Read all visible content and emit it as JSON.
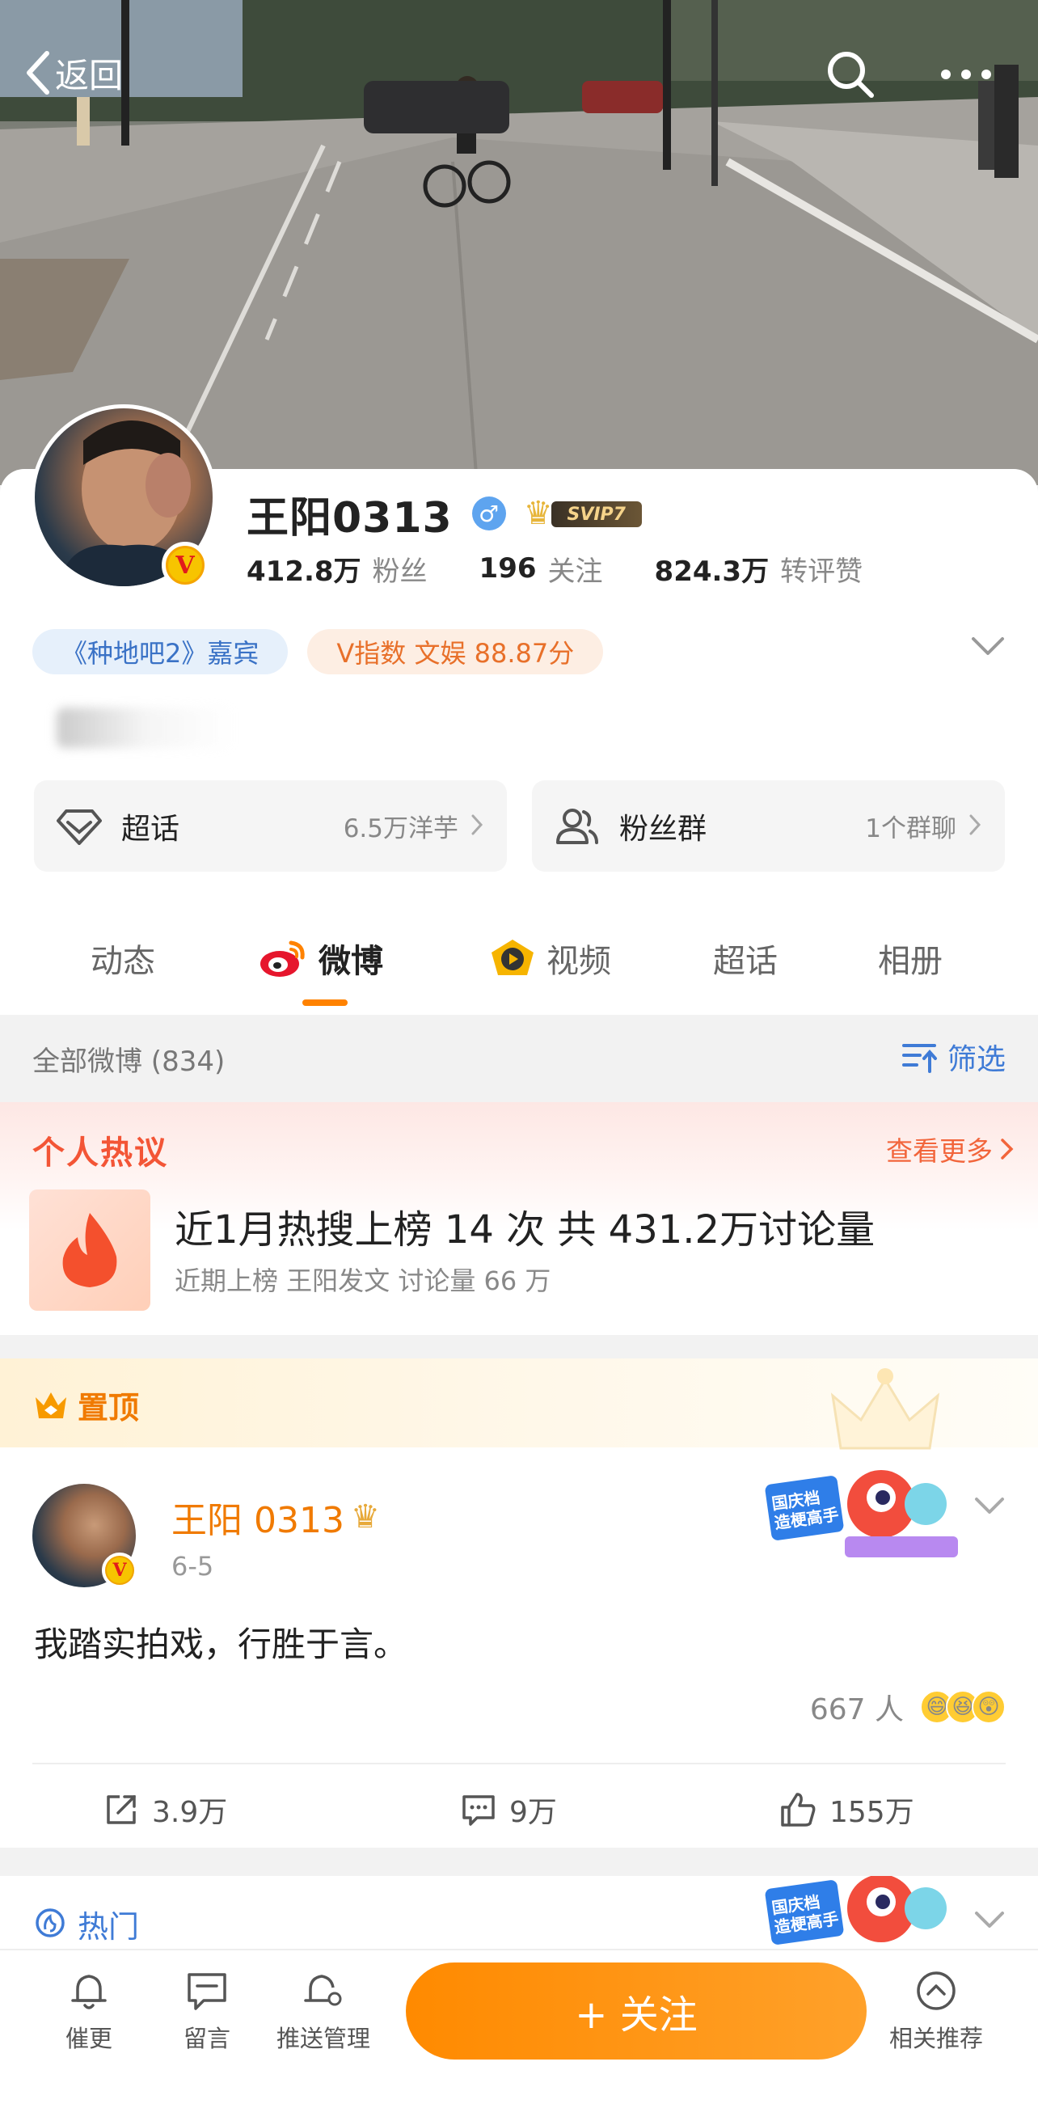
{
  "topbar": {
    "back_label": "返回"
  },
  "profile": {
    "name": "王阳0313",
    "gender_symbol": "♂",
    "svip_label": "SVIP7",
    "verified_mark": "V",
    "stats": [
      {
        "value": "412.8万",
        "label": "粉丝"
      },
      {
        "value": "196",
        "label": "关注"
      },
      {
        "value": "824.3万",
        "label": "转评赞"
      }
    ],
    "tags": [
      "《种地吧2》嘉宾",
      "V指数 文娱 88.87分"
    ],
    "entries": [
      {
        "label": "超话",
        "value": "6.5万洋芋"
      },
      {
        "label": "粉丝群",
        "value": "1个群聊"
      }
    ]
  },
  "tabs": [
    {
      "label": "动态"
    },
    {
      "label": "微博"
    },
    {
      "label": "视频"
    },
    {
      "label": "超话"
    },
    {
      "label": "相册"
    }
  ],
  "list_header": {
    "count_label": "全部微博 (834)",
    "filter_label": "筛选"
  },
  "hot_section": {
    "title": "个人热议",
    "more_label": "查看更多",
    "main_text": "近1月热搜上榜 14 次 共 431.2万讨论量",
    "sub_text": "近期上榜 王阳发文 讨论量 66 万"
  },
  "pinned_post": {
    "pin_label": "置顶",
    "author": "王阳 0313",
    "date": "6-5",
    "badge_text": "国庆档 造梗高手",
    "content": "我踏实拍戏，行胜于言。",
    "reaction_count": "667 人",
    "actions": [
      {
        "label": "3.9万"
      },
      {
        "label": "9万"
      },
      {
        "label": "155万"
      }
    ]
  },
  "hot_strip": {
    "label": "热门",
    "badge_text": "国庆档 造梗高手"
  },
  "bottom_bar": {
    "items": [
      {
        "label": "催更"
      },
      {
        "label": "留言"
      },
      {
        "label": "推送管理"
      },
      {
        "label": "相关推荐"
      }
    ],
    "follow_label": "+ 关注"
  },
  "colors": {
    "accent": "#ff8200",
    "link_blue": "#3f7bd6",
    "hot_red": "#f35536"
  }
}
